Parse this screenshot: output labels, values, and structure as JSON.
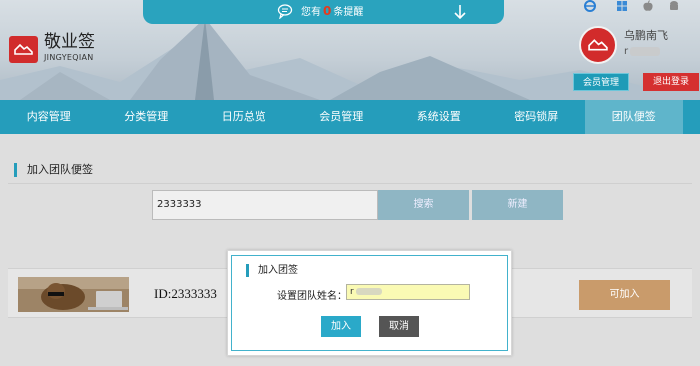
{
  "header": {
    "notice_prefix": "您有",
    "notice_count": "0",
    "notice_suffix": "条提醒",
    "brand_name": "敬业签",
    "brand_sub": "JINGYEQIAN",
    "user_name": "乌鹏南飞",
    "user_sub": "r",
    "member_button": "会员管理",
    "logout_button": "退出登录"
  },
  "nav": {
    "items": [
      "内容管理",
      "分类管理",
      "日历总览",
      "会员管理",
      "系统设置",
      "密码锁屏",
      "团队便签"
    ],
    "active_index": 6
  },
  "main": {
    "section_title": "加入团队便签",
    "search_value": "2333333",
    "search_button": "搜索",
    "new_button": "新建",
    "team": {
      "id_text": "ID:2333333",
      "join_button": "可加入"
    }
  },
  "modal": {
    "title": "加入团签",
    "label": "设置团队姓名：",
    "input_value": "r",
    "ok_button": "加入",
    "cancel_button": "取消"
  },
  "colors": {
    "primary": "#259dbb",
    "danger": "#d53030",
    "input_highlight": "#fafab4"
  },
  "icons": [
    "chat-bubble-icon",
    "arrow-down-icon",
    "ie-icon",
    "windows-icon",
    "apple-icon",
    "android-icon",
    "cloud-logo-icon"
  ]
}
